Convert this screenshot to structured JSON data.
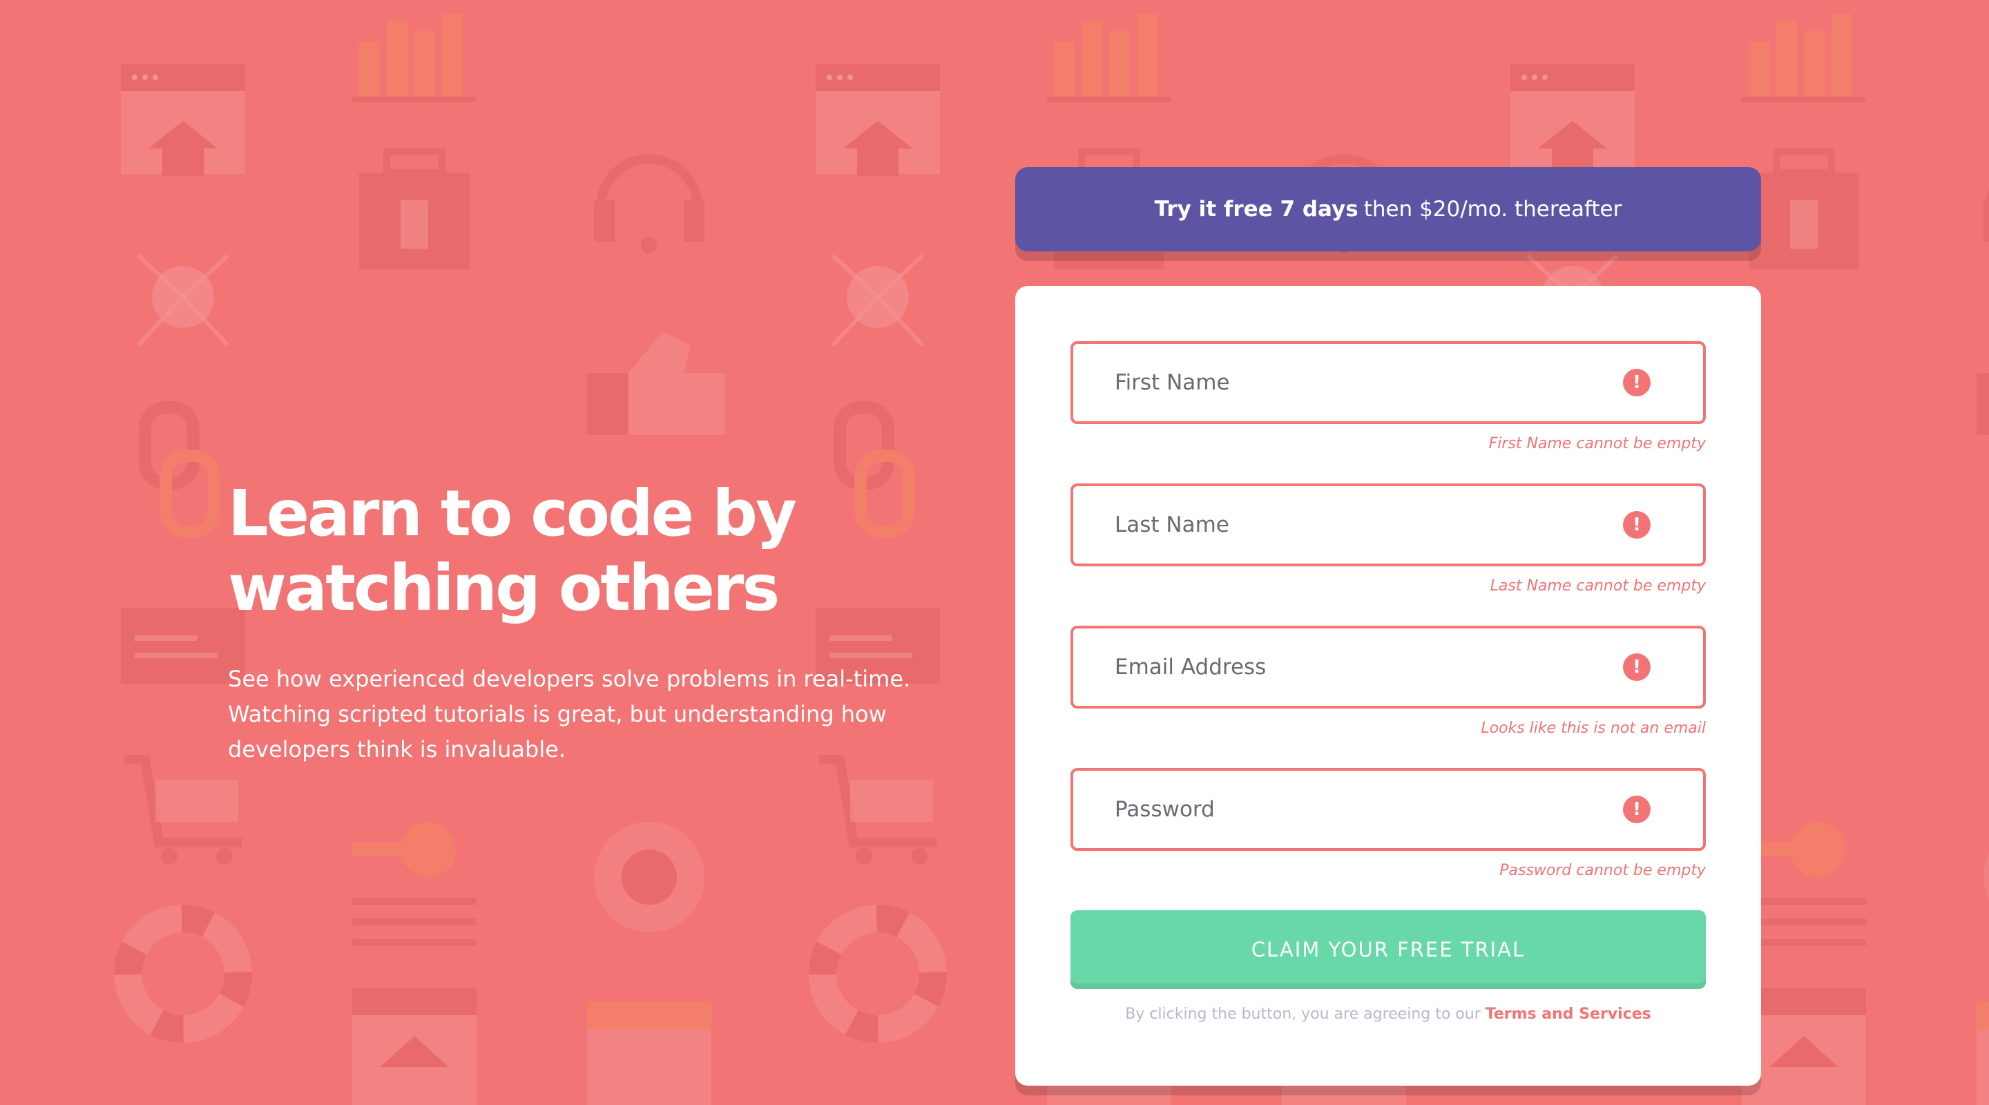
{
  "hero": {
    "title_line1": "Learn to code by",
    "title_line2": "watching others",
    "description": "See how experienced developers solve problems in real-time. Watching scripted tutorials is great, but understanding how developers think is invaluable."
  },
  "promo": {
    "bold_text": "Try it free 7 days",
    "rest_text": "then $20/mo. thereafter"
  },
  "form": {
    "fields": [
      {
        "placeholder": "First Name",
        "error": "First Name cannot be empty"
      },
      {
        "placeholder": "Last Name",
        "error": "Last Name cannot be empty"
      },
      {
        "placeholder": "Email Address",
        "error": "Looks like this is not an email"
      },
      {
        "placeholder": "Password",
        "error": "Password cannot be empty"
      }
    ],
    "error_icon": "!",
    "submit_label": "Claim your free trial",
    "terms_prefix": "By clicking the button, you are agreeing to our",
    "terms_link": "Terms and Services"
  },
  "colors": {
    "background": "#f27474",
    "promo": "#5e54a4",
    "error": "#f27474",
    "submit": "#38cc8b"
  }
}
